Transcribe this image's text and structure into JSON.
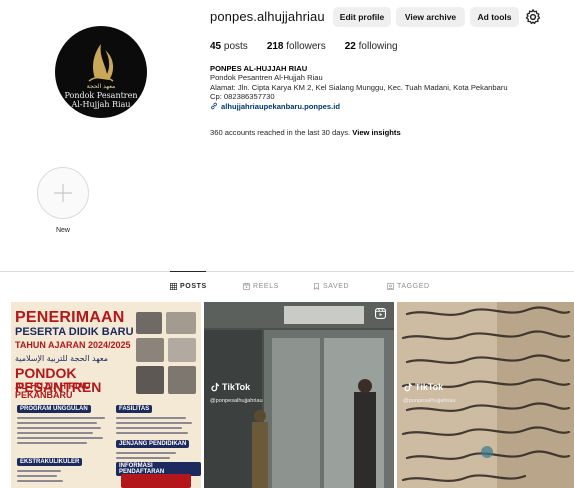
{
  "profile": {
    "username": "ponpes.alhujjahriau",
    "avatar": {
      "arabic_text": "معهد الحجة",
      "line1": "Pondok Pesantren",
      "line2": "Al-Hujjah Riau"
    },
    "buttons": {
      "edit": "Edit profile",
      "archive": "View archive",
      "adtools": "Ad tools"
    },
    "stats": {
      "posts_count": "45",
      "posts_label": "posts",
      "followers_count": "218",
      "followers_label": "followers",
      "following_count": "22",
      "following_label": "following"
    },
    "bio": {
      "name": "PONPES AL-HUJJAH RIAU",
      "line1": "Pondok Pesantren Al-Hujjah Riau",
      "line2": "Alamat: Jln. Cipta Karya KM 2, Kel Sialang Munggu, Kec. Tuah Madani, Kota Pekanbaru",
      "line3": "Cp: 082386357730",
      "link": "alhujjahriaupekanbaru.ponpes.id"
    },
    "reach": {
      "text": "360 accounts reached in the last 30 days.",
      "action": "View insights"
    }
  },
  "highlights": {
    "new_label": "New"
  },
  "tabs": {
    "posts": "POSTS",
    "reels": "REELS",
    "saved": "SAVED",
    "tagged": "TAGGED"
  },
  "posts": {
    "poster": {
      "t1": "PENERIMAAN",
      "t2": "PESERTA DIDIK BARU",
      "t3": "TAHUN AJARAN 2024/2025",
      "arabic": "معهد الحجة للتربية الإسلامية",
      "t4": "PONDOK PESANTREN",
      "t5": "AL-HUJJAH RIAU PEKANBARU",
      "sec_program": "PROGRAM UNGGULAN",
      "sec_fasilitas": "FASILITAS",
      "sec_jenjang": "JENJANG PENDIDIKAN",
      "sec_ekstra": "EKSTRAKULIKULER",
      "sec_info": "INFORMASI PENDAFTARAN"
    },
    "tiktok_label": "TikTok",
    "tiktok_handle": "@ponpesalhujjahriau"
  },
  "colors": {
    "accent_link": "#00376b",
    "poster_red": "#b3171b",
    "poster_navy": "#1d2a5e"
  }
}
